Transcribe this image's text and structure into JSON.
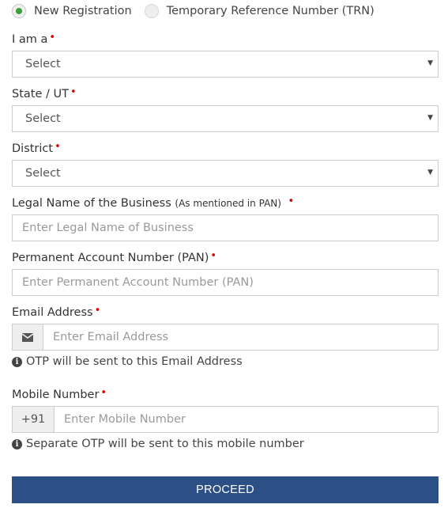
{
  "registration_type": {
    "options": [
      {
        "label": "New Registration",
        "checked": true
      },
      {
        "label": "Temporary Reference Number (TRN)",
        "checked": false
      }
    ]
  },
  "required_marker": "•",
  "fields": {
    "i_am_a": {
      "label": "I am a",
      "value": "Select"
    },
    "state": {
      "label": "State / UT",
      "value": "Select"
    },
    "district": {
      "label": "District",
      "value": "Select"
    },
    "legal_name": {
      "label": "Legal Name of the Business",
      "sublabel": "(As mentioned in PAN)",
      "placeholder": "Enter Legal Name of Business"
    },
    "pan": {
      "label": "Permanent Account Number (PAN)",
      "placeholder": "Enter Permanent Account Number (PAN)"
    },
    "email": {
      "label": "Email Address",
      "placeholder": "Enter Email Address",
      "icon": "envelope-icon",
      "help": "OTP will be sent to this Email Address"
    },
    "mobile": {
      "label": "Mobile Number",
      "prefix": "+91",
      "placeholder": "Enter Mobile Number",
      "help": "Separate OTP will be sent to this mobile number"
    }
  },
  "proceed_label": "PROCEED",
  "colors": {
    "accent_green": "#3aa03a",
    "required_red": "#e00000",
    "button_blue": "#2c4f85"
  }
}
